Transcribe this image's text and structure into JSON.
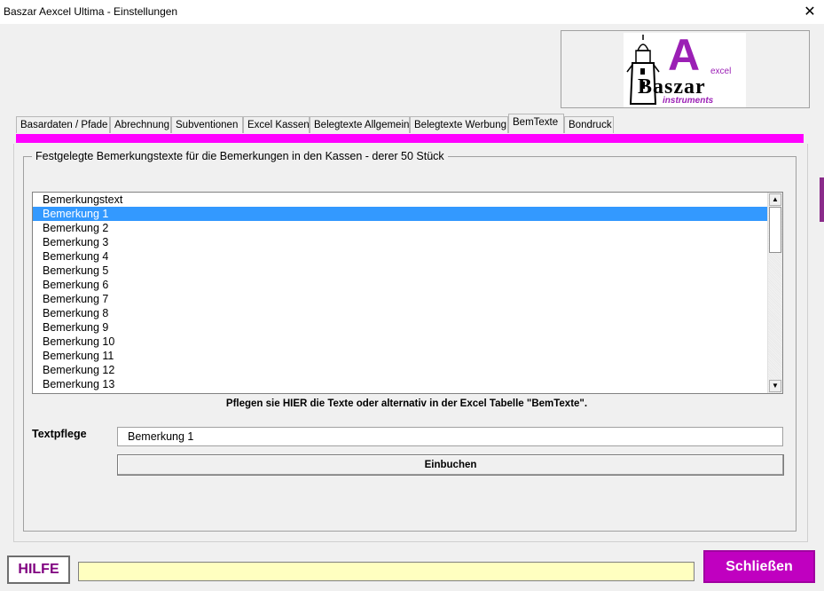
{
  "window": {
    "title": "Baszar Aexcel Ultima - Einstellungen",
    "close_glyph": "✕"
  },
  "logo": {
    "big_letter": "A",
    "small_word": "excel",
    "brand": "Baszar",
    "sub": "instruments"
  },
  "tabs": [
    {
      "label": "Basardaten / Pfade",
      "active": false
    },
    {
      "label": "Abrechnung",
      "active": false
    },
    {
      "label": "Subventionen",
      "active": false
    },
    {
      "label": "Excel Kassen",
      "active": false
    },
    {
      "label": "Belegtexte Allgemein",
      "active": false
    },
    {
      "label": "Belegtexte Werbung",
      "active": false
    },
    {
      "label": "BemTexte",
      "active": true
    },
    {
      "label": "Bondruck",
      "active": false
    }
  ],
  "frame": {
    "label": "Festgelegte Bemerkungstexte für die Bemerkungen in den Kassen - derer 50 Stück"
  },
  "list": {
    "items": [
      "Bemerkungstext",
      "Bemerkung 1",
      "Bemerkung 2",
      "Bemerkung 3",
      "Bemerkung 4",
      "Bemerkung 5",
      "Bemerkung 6",
      "Bemerkung 7",
      "Bemerkung 8",
      "Bemerkung 9",
      "Bemerkung 10",
      "Bemerkung 11",
      "Bemerkung 12",
      "Bemerkung 13"
    ],
    "selected_index": 1,
    "scroll_up_glyph": "▲",
    "scroll_down_glyph": "▼"
  },
  "hint": "Pflegen sie HIER die Texte oder alternativ in der Excel Tabelle \"BemTexte\".",
  "textpflege": {
    "label": "Textpflege",
    "value": "Bemerkung 1"
  },
  "buttons": {
    "einbuchen": "Einbuchen",
    "hilfe": "HILFE",
    "schliessen": "Schließen"
  },
  "status": {
    "text": ""
  },
  "colors": {
    "accent_magenta": "#ff00ff",
    "selection": "#3399ff",
    "close_button": "#c000c0",
    "status_bg": "#ffffc0",
    "logo_purple": "#9b1fb5"
  }
}
